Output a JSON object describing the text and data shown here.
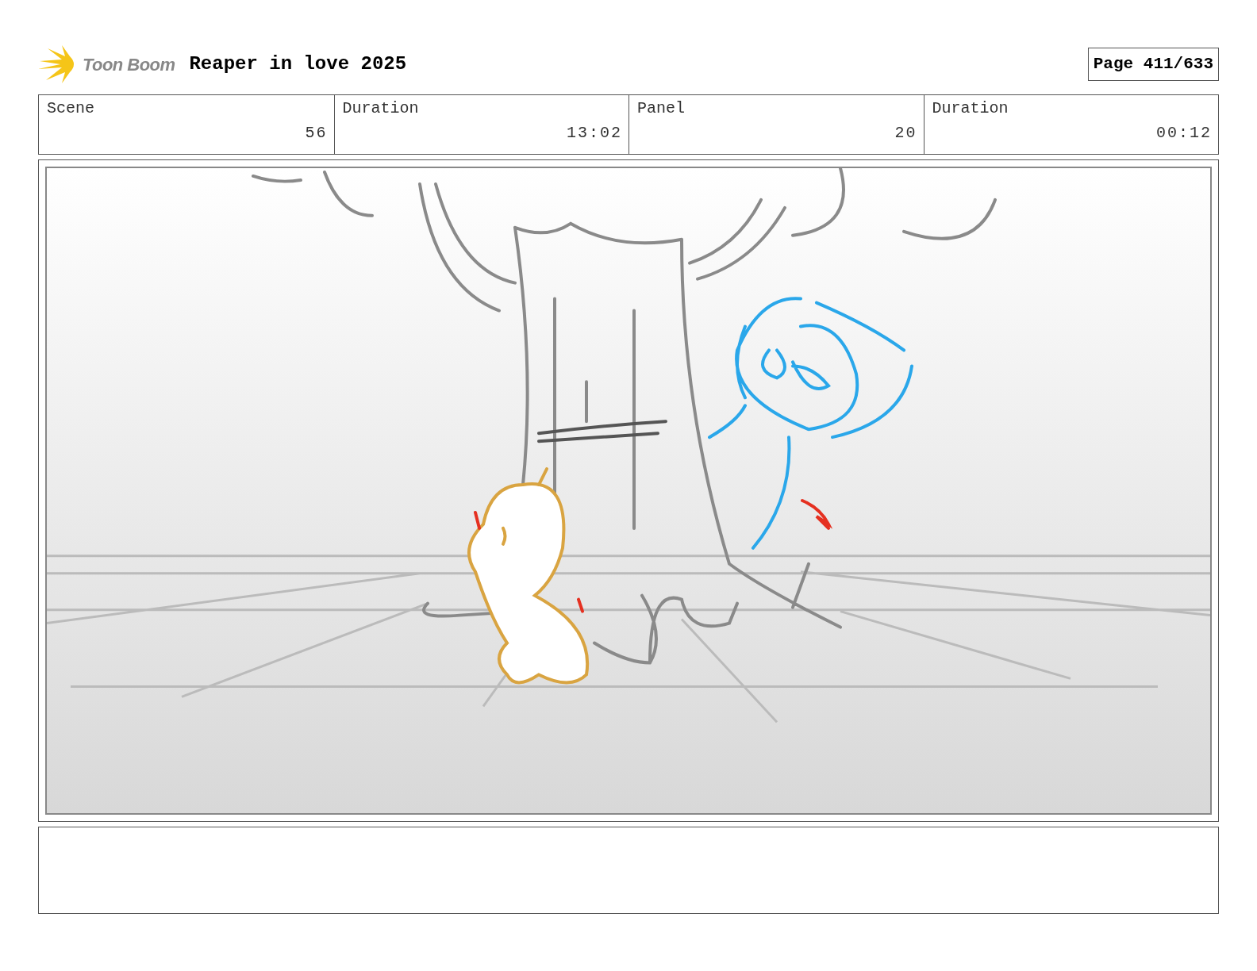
{
  "header": {
    "logo_text": "Toon Boom",
    "title": "Reaper in love 2025",
    "page": "Page 411/633"
  },
  "info": [
    {
      "label": "Scene",
      "value": "56"
    },
    {
      "label": "Duration",
      "value": "13:02"
    },
    {
      "label": "Panel",
      "value": "20"
    },
    {
      "label": "Duration",
      "value": "00:12"
    }
  ]
}
